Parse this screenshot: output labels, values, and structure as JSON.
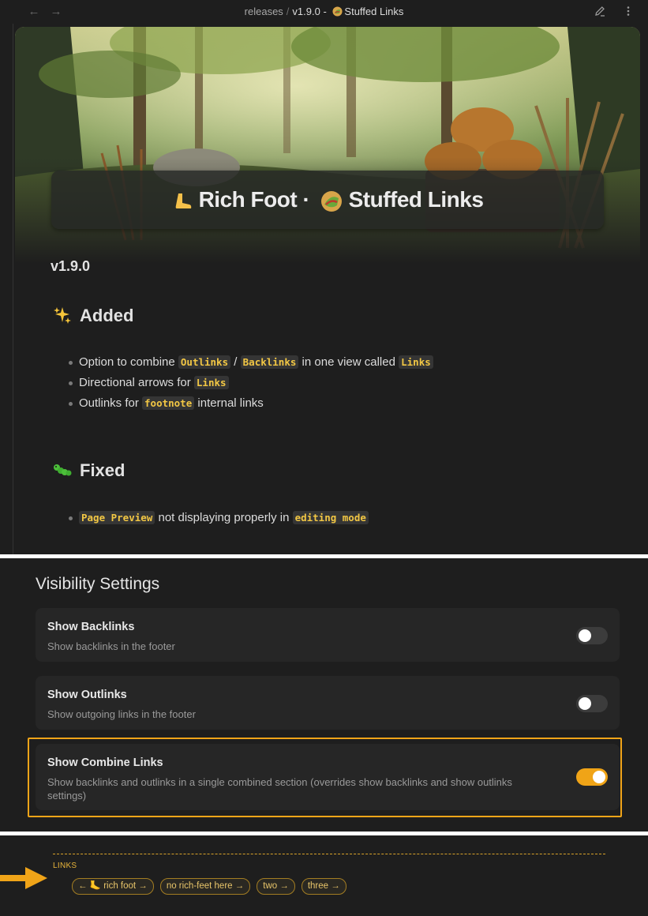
{
  "topbar": {
    "breadcrumb": [
      "releases",
      "v1.9.0 -"
    ],
    "current_title": "Stuffed Links",
    "back_icon": "arrow-left-icon",
    "forward_icon": "arrow-right-icon",
    "edit_icon": "pencil-icon",
    "more_icon": "more-vertical-icon"
  },
  "note": {
    "title_part1": "Rich Foot ·",
    "title_part2": "Stuffed Links",
    "version": "v1.9.0",
    "sections": [
      {
        "heading": "Added",
        "icon": "sparkles-icon",
        "items": [
          {
            "before": "Option to combine ",
            "code1": "Outlinks",
            "mid1": " / ",
            "code2": "Backlinks",
            "mid2": " in one view called ",
            "code3": "Links"
          },
          {
            "before": "Directional arrows for ",
            "code1": "Links"
          },
          {
            "before": "Outlinks for ",
            "code1": "footnote",
            "after": " internal links"
          }
        ]
      },
      {
        "heading": "Fixed",
        "icon": "caterpillar-icon",
        "items": [
          {
            "code1": "Page Preview",
            "mid1": " not displaying properly in ",
            "code2": "editing mode"
          }
        ]
      }
    ]
  },
  "settings": {
    "title": "Visibility Settings",
    "items": [
      {
        "name": "Show Backlinks",
        "desc": "Show backlinks in the footer",
        "enabled": false
      },
      {
        "name": "Show Outlinks",
        "desc": "Show outgoing links in the footer",
        "enabled": false
      },
      {
        "name": "Show Combine Links",
        "desc": "Show backlinks and outlinks in a single combined section (overrides show backlinks and show outlinks settings)",
        "enabled": true
      }
    ]
  },
  "links_footer": {
    "label": "LINKS",
    "chips": [
      {
        "text": "← 🦶 rich foot →"
      },
      {
        "text": "no rich-feet here →"
      },
      {
        "text": "two →"
      },
      {
        "text": "three →"
      }
    ]
  },
  "colors": {
    "accent": "#f0a417",
    "code_text": "#f2c744",
    "background": "#1e1e1e"
  }
}
